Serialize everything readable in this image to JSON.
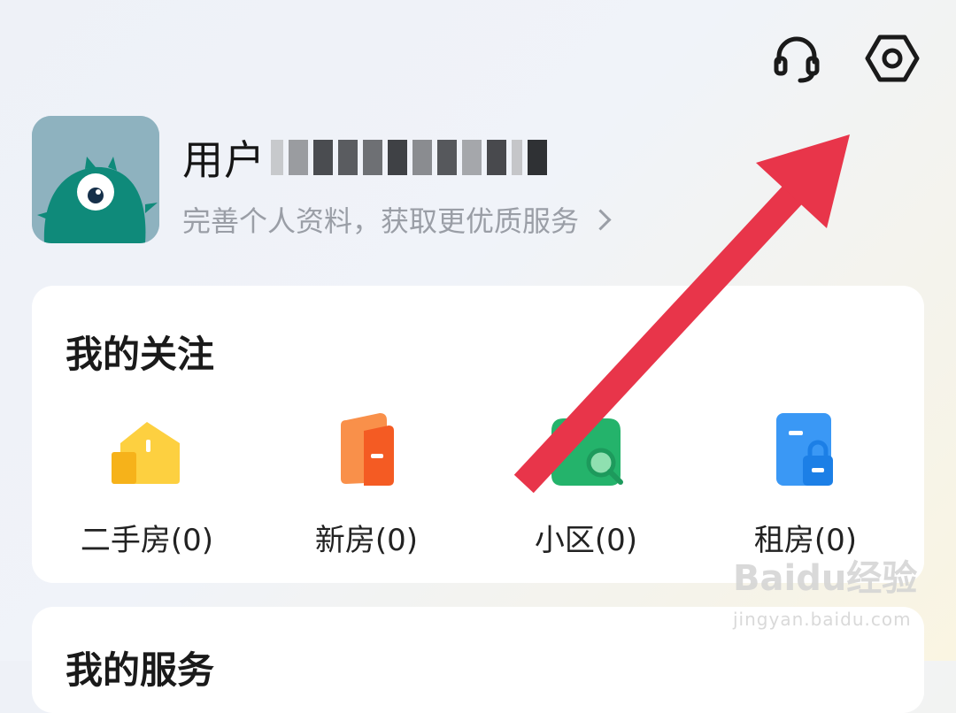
{
  "header": {
    "support_icon": "headset-icon",
    "settings_icon": "hexagon-settings-icon"
  },
  "profile": {
    "name_visible": "用户",
    "name_obscured": true,
    "subtitle": "完善个人资料，获取更优质服务",
    "avatar_color": "#8eb2bf"
  },
  "follow_section": {
    "title": "我的关注",
    "items": [
      {
        "label": "二手房(0)",
        "icon": "second-hand-house-icon",
        "color": "#fcc630"
      },
      {
        "label": "新房(0)",
        "icon": "new-house-icon",
        "color": "#f86a2e"
      },
      {
        "label": "小区(0)",
        "icon": "community-icon",
        "color": "#24b36b"
      },
      {
        "label": "租房(0)",
        "icon": "rental-icon",
        "color": "#3a98f5"
      }
    ]
  },
  "service_section": {
    "title": "我的服务"
  },
  "annotation": {
    "arrow_color": "#e8354a",
    "points_to": "settings-icon"
  },
  "watermark": {
    "main": "Baidu经验",
    "sub": "jingyan.baidu.com"
  }
}
